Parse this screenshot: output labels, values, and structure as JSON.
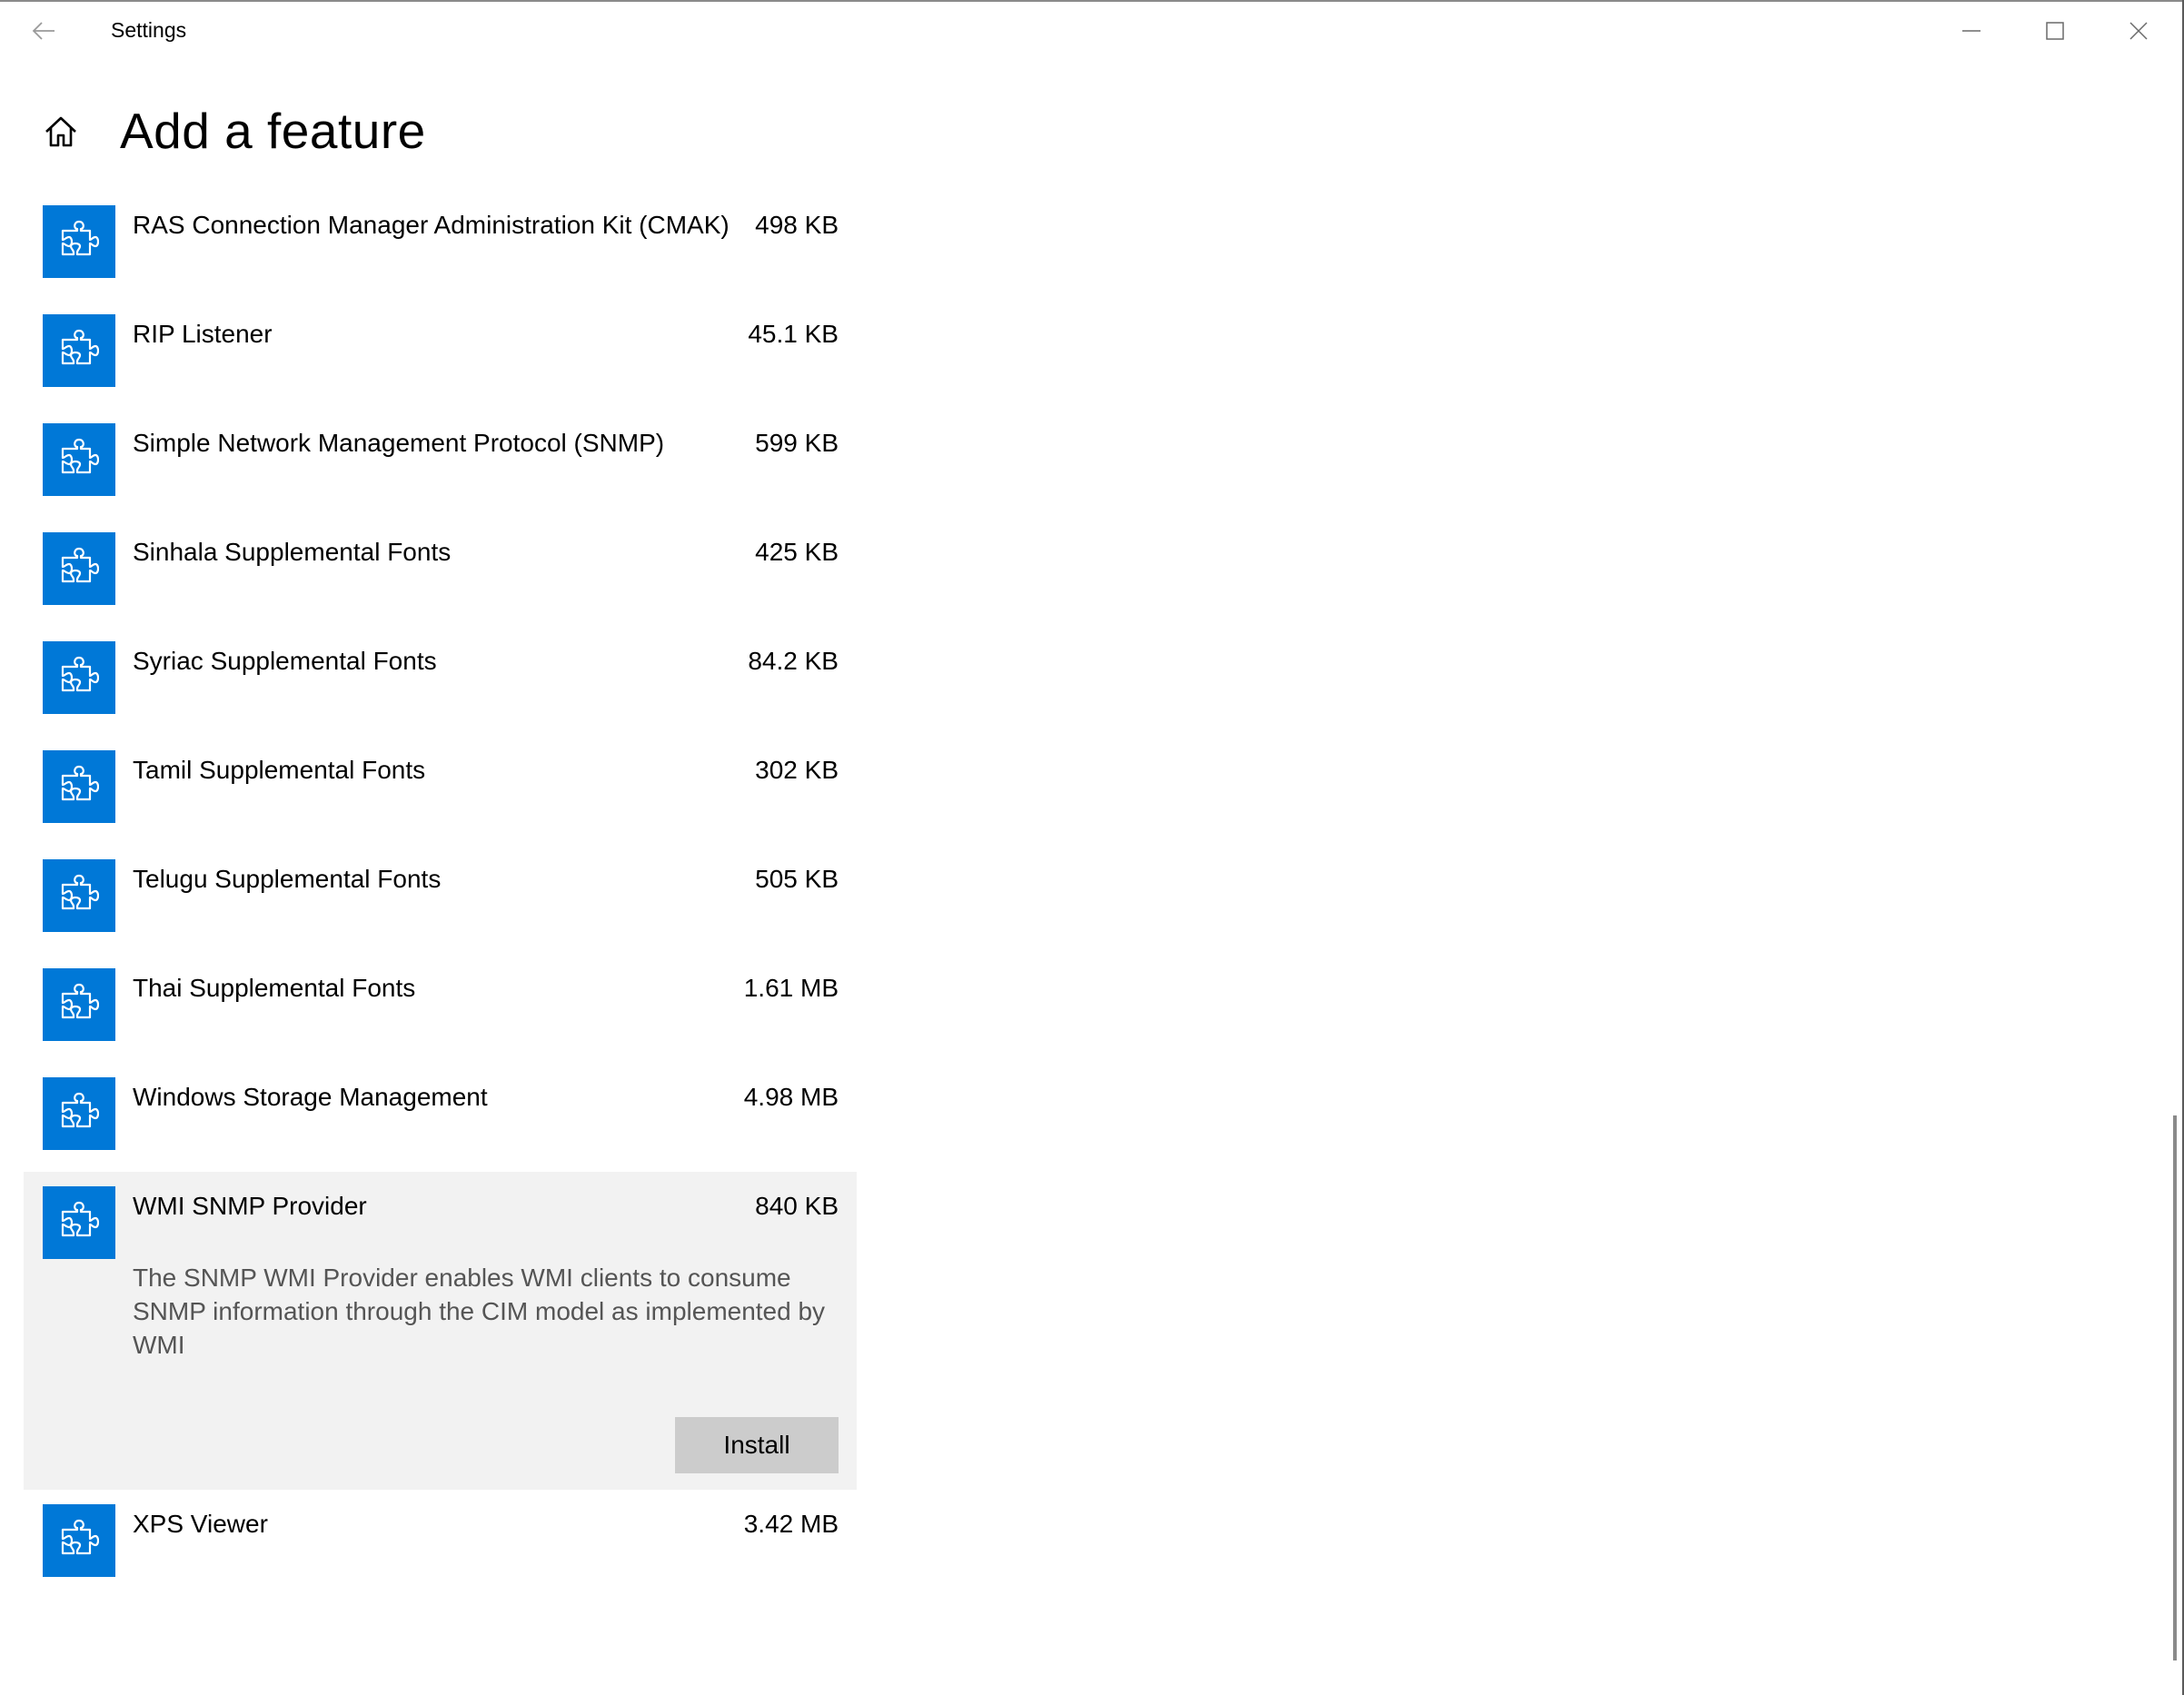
{
  "window": {
    "title": "Settings",
    "back_icon": "back-arrow-icon",
    "minimize_icon": "minimize-icon",
    "maximize_icon": "maximize-icon",
    "close_icon": "close-icon"
  },
  "header": {
    "home_icon": "home-icon",
    "title": "Add a feature"
  },
  "features": [
    {
      "name": "RAS Connection Manager Administration Kit (CMAK)",
      "size": "498 KB"
    },
    {
      "name": "RIP Listener",
      "size": "45.1 KB"
    },
    {
      "name": "Simple Network Management Protocol (SNMP)",
      "size": "599 KB"
    },
    {
      "name": "Sinhala Supplemental Fonts",
      "size": "425 KB"
    },
    {
      "name": "Syriac Supplemental Fonts",
      "size": "84.2 KB"
    },
    {
      "name": "Tamil Supplemental Fonts",
      "size": "302 KB"
    },
    {
      "name": "Telugu Supplemental Fonts",
      "size": "505 KB"
    },
    {
      "name": "Thai Supplemental Fonts",
      "size": "1.61 MB"
    },
    {
      "name": "Windows Storage Management",
      "size": "4.98 MB"
    },
    {
      "name": "WMI SNMP Provider",
      "size": "840 KB",
      "description": "The SNMP WMI Provider enables WMI clients to  consume SNMP information through the CIM model as implemented by WMI",
      "install_label": "Install",
      "expanded": true
    },
    {
      "name": "XPS Viewer",
      "size": "3.42 MB"
    }
  ],
  "colors": {
    "accent": "#0078d7",
    "expanded_background": "#f2f2f2",
    "install_button": "#cccccc",
    "description_text": "#555555"
  },
  "icons": {
    "feature_icon": "puzzle-piece-icon"
  }
}
